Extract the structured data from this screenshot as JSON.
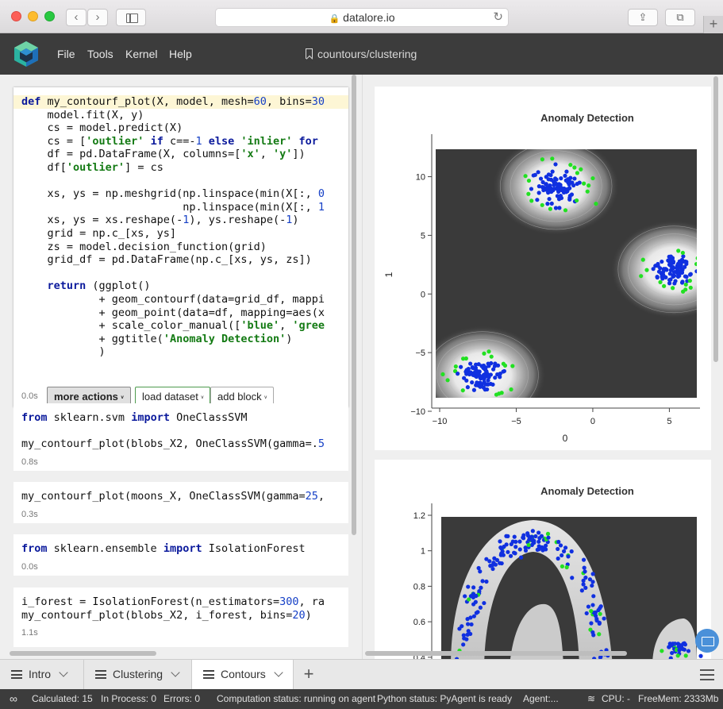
{
  "browser": {
    "url": "datalore.io"
  },
  "app": {
    "menu": [
      "File",
      "Tools",
      "Kernel",
      "Help"
    ],
    "notebook_path": "countours/clustering"
  },
  "cells": {
    "c1": {
      "lines": [
        [
          [
            "kw",
            "def "
          ],
          [
            "",
            "my_contourf_plot(X, model, mesh="
          ],
          [
            "num",
            "60"
          ],
          [
            "",
            ", bins="
          ],
          [
            "num",
            "30"
          ]
        ],
        [
          [
            "",
            "    model.fit(X, y)"
          ]
        ],
        [
          [
            "",
            "    cs = model.predict(X)"
          ]
        ],
        [
          [
            "",
            "    cs = ["
          ],
          [
            "str",
            "'outlier'"
          ],
          [
            "kw",
            " if "
          ],
          [
            "",
            "c==-"
          ],
          [
            "num",
            "1"
          ],
          [
            "kw",
            " else "
          ],
          [
            "str",
            "'inlier'"
          ],
          [
            "kw",
            " for"
          ]
        ],
        [
          [
            "",
            "    df = pd.DataFrame(X, columns=["
          ],
          [
            "str",
            "'x'"
          ],
          [
            "",
            ", "
          ],
          [
            "str",
            "'y'"
          ],
          [
            "",
            "])"
          ]
        ],
        [
          [
            "",
            "    df["
          ],
          [
            "str",
            "'outlier'"
          ],
          [
            "",
            "] = cs"
          ]
        ],
        [
          [
            "",
            ""
          ]
        ],
        [
          [
            "",
            "    xs, ys = np.meshgrid(np.linspace(min(X[:, "
          ],
          [
            "num",
            "0"
          ]
        ],
        [
          [
            "",
            "                         np.linspace(min(X[:, "
          ],
          [
            "num",
            "1"
          ]
        ],
        [
          [
            "",
            "    xs, ys = xs.reshape(-"
          ],
          [
            "num",
            "1"
          ],
          [
            "",
            "), ys.reshape(-"
          ],
          [
            "num",
            "1"
          ],
          [
            "",
            ")"
          ]
        ],
        [
          [
            "",
            "    grid = np.c_[xs, ys]"
          ]
        ],
        [
          [
            "",
            "    zs = model.decision_function(grid)"
          ]
        ],
        [
          [
            "",
            "    grid_df = pd.DataFrame(np.c_[xs, ys, zs])"
          ]
        ],
        [
          [
            "",
            ""
          ]
        ],
        [
          [
            "kw",
            "    return "
          ],
          [
            "",
            "(ggplot()"
          ]
        ],
        [
          [
            "",
            "            + geom_contourf(data=grid_df, mappi"
          ]
        ],
        [
          [
            "",
            "            + geom_point(data=df, mapping=aes(x"
          ]
        ],
        [
          [
            "",
            "            + scale_color_manual(["
          ],
          [
            "str",
            "'blue'"
          ],
          [
            "",
            ", "
          ],
          [
            "str",
            "'gree"
          ]
        ],
        [
          [
            "",
            "            + ggtitle("
          ],
          [
            "str",
            "'Anomaly Detection'"
          ],
          [
            "",
            ")"
          ]
        ],
        [
          [
            "",
            "            )"
          ]
        ]
      ],
      "time": "0.0s",
      "more_actions": "more actions",
      "load_dataset": "load dataset",
      "add_block": "add block"
    },
    "c2": {
      "lines": [
        [
          [
            "kw",
            "from "
          ],
          [
            "",
            "sklearn.svm "
          ],
          [
            "kw",
            "import "
          ],
          [
            "",
            "OneClassSVM"
          ]
        ],
        [
          [
            "",
            ""
          ]
        ],
        [
          [
            "",
            "my_contourf_plot(blobs_X2, OneClassSVM(gamma=."
          ],
          [
            "num",
            "5"
          ]
        ]
      ],
      "time": "0.8s"
    },
    "c3": {
      "lines": [
        [
          [
            "",
            "my_contourf_plot(moons_X, OneClassSVM(gamma="
          ],
          [
            "num",
            "25"
          ],
          [
            "",
            ","
          ]
        ]
      ],
      "time": "0.3s"
    },
    "c4": {
      "lines": [
        [
          [
            "kw",
            "from "
          ],
          [
            "",
            "sklearn.ensemble "
          ],
          [
            "kw",
            "import "
          ],
          [
            "",
            "IsolationForest"
          ]
        ]
      ],
      "time": "0.0s"
    },
    "c5": {
      "lines": [
        [
          [
            "",
            "i_forest = IsolationForest(n_estimators="
          ],
          [
            "num",
            "300"
          ],
          [
            "",
            ", ra"
          ]
        ],
        [
          [
            "",
            "my_contourf_plot(blobs_X2, i_forest, bins="
          ],
          [
            "num",
            "20"
          ],
          [
            "",
            ")"
          ]
        ]
      ],
      "time": "1.1s"
    }
  },
  "chart_data": [
    {
      "type": "scatter",
      "title": "Anomaly Detection",
      "xlabel": "0",
      "ylabel": "1",
      "xlim": [
        -10,
        7
      ],
      "ylim": [
        -10,
        12
      ],
      "xticks": [
        "−10",
        "−5",
        "0",
        "5"
      ],
      "yticks": [
        "−10",
        "−5",
        "0",
        "5",
        "10"
      ],
      "clusters": [
        {
          "cx": -2.4,
          "cy": 9.2,
          "sx": 0.9,
          "sy": 1.0,
          "n": 110,
          "seed": 11
        },
        {
          "cx": 5.3,
          "cy": 2.1,
          "sx": 0.8,
          "sy": 0.7,
          "n": 110,
          "seed": 23
        },
        {
          "cx": -7.2,
          "cy": -6.9,
          "sx": 0.9,
          "sy": 0.8,
          "n": 110,
          "seed": 37
        }
      ],
      "colors": {
        "inlier": "#1030e0",
        "outlier": "#22e022"
      }
    },
    {
      "type": "scatter",
      "title": "Anomaly Detection",
      "ylim": [
        0.35,
        1.2
      ],
      "yticks": [
        "0.4",
        "0.6",
        "0.8",
        "1",
        "1.2"
      ],
      "colors": {
        "inlier": "#1030e0",
        "outlier": "#22e022"
      }
    }
  ],
  "tabs": [
    "Intro",
    "Clustering",
    "Contours"
  ],
  "status": {
    "calculated": "Calculated: 15",
    "in_process": "In Process: 0",
    "errors": "Errors: 0",
    "computation": "Computation status: running on agent",
    "python": "Python status: PyAgent is ready",
    "agent": "Agent:...",
    "cpu": "CPU: -",
    "freemem": "FreeMem: 2333Mb"
  }
}
